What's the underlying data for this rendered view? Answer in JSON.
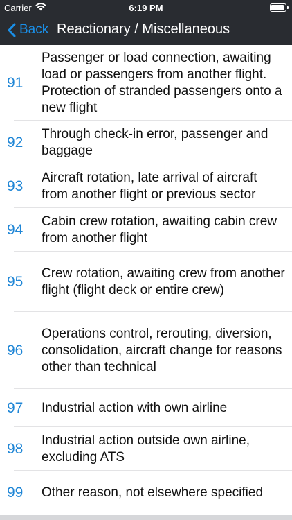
{
  "status_bar": {
    "carrier": "Carrier",
    "time": "6:19 PM",
    "battery_level": 1.0,
    "wifi_icon": "wifi-icon",
    "battery_icon": "battery-icon"
  },
  "nav": {
    "back_label": "Back",
    "back_icon": "chevron-left-icon",
    "title": "Reactionary / Miscellaneous",
    "accent_color": "#1a8fe8",
    "bar_color": "#292c31"
  },
  "items": [
    {
      "code": "91",
      "description": "Passenger or load connection, awaiting load or passengers from another flight. Protection of stranded passengers onto a new flight"
    },
    {
      "code": "92",
      "description": "Through check-in error, passenger and baggage"
    },
    {
      "code": "93",
      "description": "Aircraft rotation, late arrival of aircraft from another flight or previous sector"
    },
    {
      "code": "94",
      "description": "Cabin crew rotation, awaiting cabin crew from another flight"
    },
    {
      "code": "95",
      "description": "Crew rotation, awaiting crew from another flight (flight deck or entire crew)"
    },
    {
      "code": "96",
      "description": "Operations control, rerouting, diversion, consolidation, aircraft change for reasons other than technical"
    },
    {
      "code": "97",
      "description": "Industrial action with own airline"
    },
    {
      "code": "98",
      "description": "Industrial action outside own airline, excluding ATS"
    },
    {
      "code": "99",
      "description": "Other reason, not elsewhere specified"
    }
  ]
}
